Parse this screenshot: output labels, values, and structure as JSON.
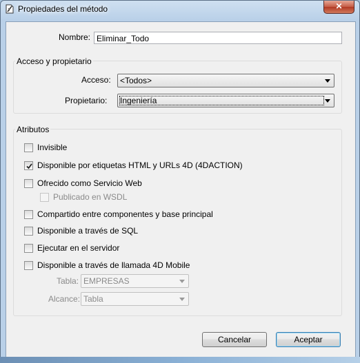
{
  "window": {
    "title": "Propiedades del método",
    "close_glyph": "✕"
  },
  "nombre": {
    "label": "Nombre:",
    "value": "Eliminar_Todo"
  },
  "acceso_group": {
    "title": "Acceso y propietario",
    "acceso_label": "Acceso:",
    "acceso_value": "<Todos>",
    "propietario_label": "Propietario:",
    "propietario_value": "Ingeniería"
  },
  "atributos": {
    "title": "Atributos",
    "options": [
      {
        "label": "Invisible",
        "checked": false,
        "enabled": true
      },
      {
        "label": "Disponible por etiquetas HTML y URLs 4D (4DACTION)",
        "checked": true,
        "enabled": true
      },
      {
        "label": "Ofrecido como Servicio Web",
        "checked": false,
        "enabled": true
      },
      {
        "label": "Publicado en WSDL",
        "checked": false,
        "enabled": false
      },
      {
        "label": "Compartido entre componentes y base principal",
        "checked": false,
        "enabled": true
      },
      {
        "label": "Disponible a través de SQL",
        "checked": false,
        "enabled": true
      },
      {
        "label": "Ejecutar en el servidor",
        "checked": false,
        "enabled": true
      },
      {
        "label": "Disponible a través de llamada 4D Mobile",
        "checked": false,
        "enabled": true
      }
    ],
    "tabla_label": "Tabla:",
    "tabla_value": "EMPRESAS",
    "alcance_label": "Alcance:",
    "alcance_value": "Tabla"
  },
  "buttons": {
    "cancel": "Cancelar",
    "accept": "Aceptar"
  },
  "icons": {
    "title_icon": "method-properties-icon",
    "check_mark": "check-icon"
  }
}
